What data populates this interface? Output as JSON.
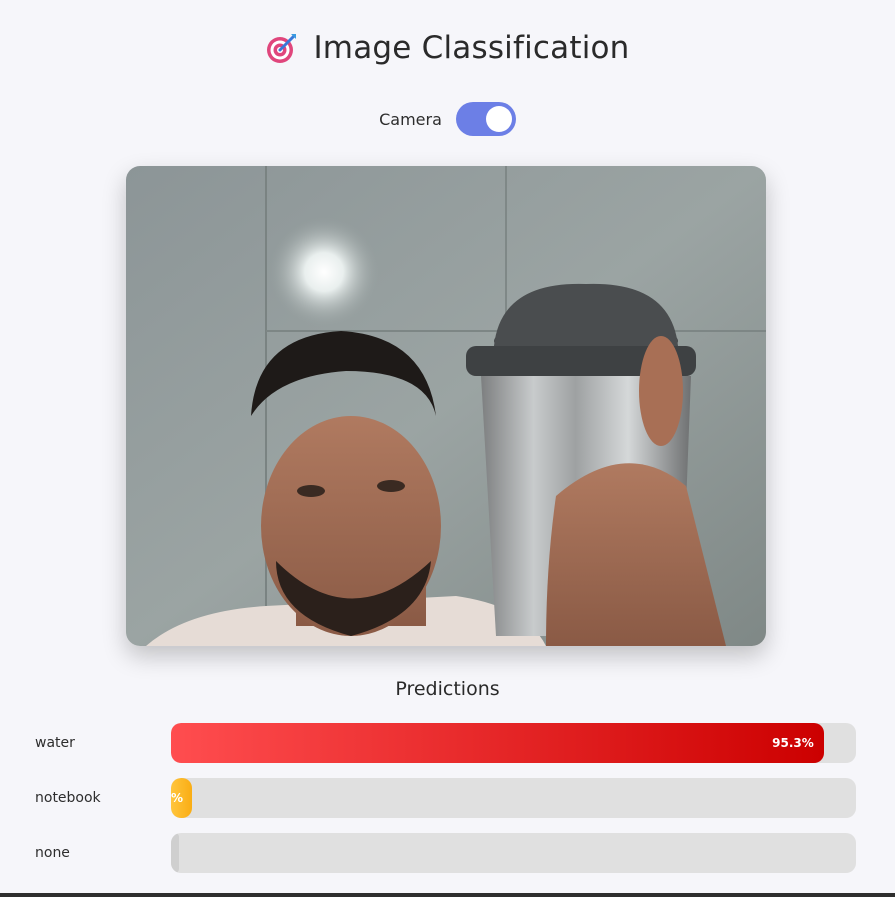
{
  "header": {
    "title": "Image Classification",
    "icon": "target-dart-icon"
  },
  "camera_toggle": {
    "label": "Camera",
    "enabled": true,
    "accent_color": "#6c7fe6"
  },
  "camera_feed": {
    "content": "live-webcam-feed"
  },
  "predictions": {
    "title": "Predictions",
    "items": [
      {
        "label": "water",
        "percent_text": "95.3%",
        "value": 0.953,
        "color_from": "#ff4d4f",
        "color_to": "#cc0000"
      },
      {
        "label": "notebook",
        "percent_text": "%",
        "value": 0.03,
        "color_from": "#ffc53d",
        "color_to": "#faad14"
      },
      {
        "label": "none",
        "percent_text": "",
        "value": 0.012,
        "color_from": "#cfcfcf",
        "color_to": "#cfcfcf"
      }
    ]
  }
}
